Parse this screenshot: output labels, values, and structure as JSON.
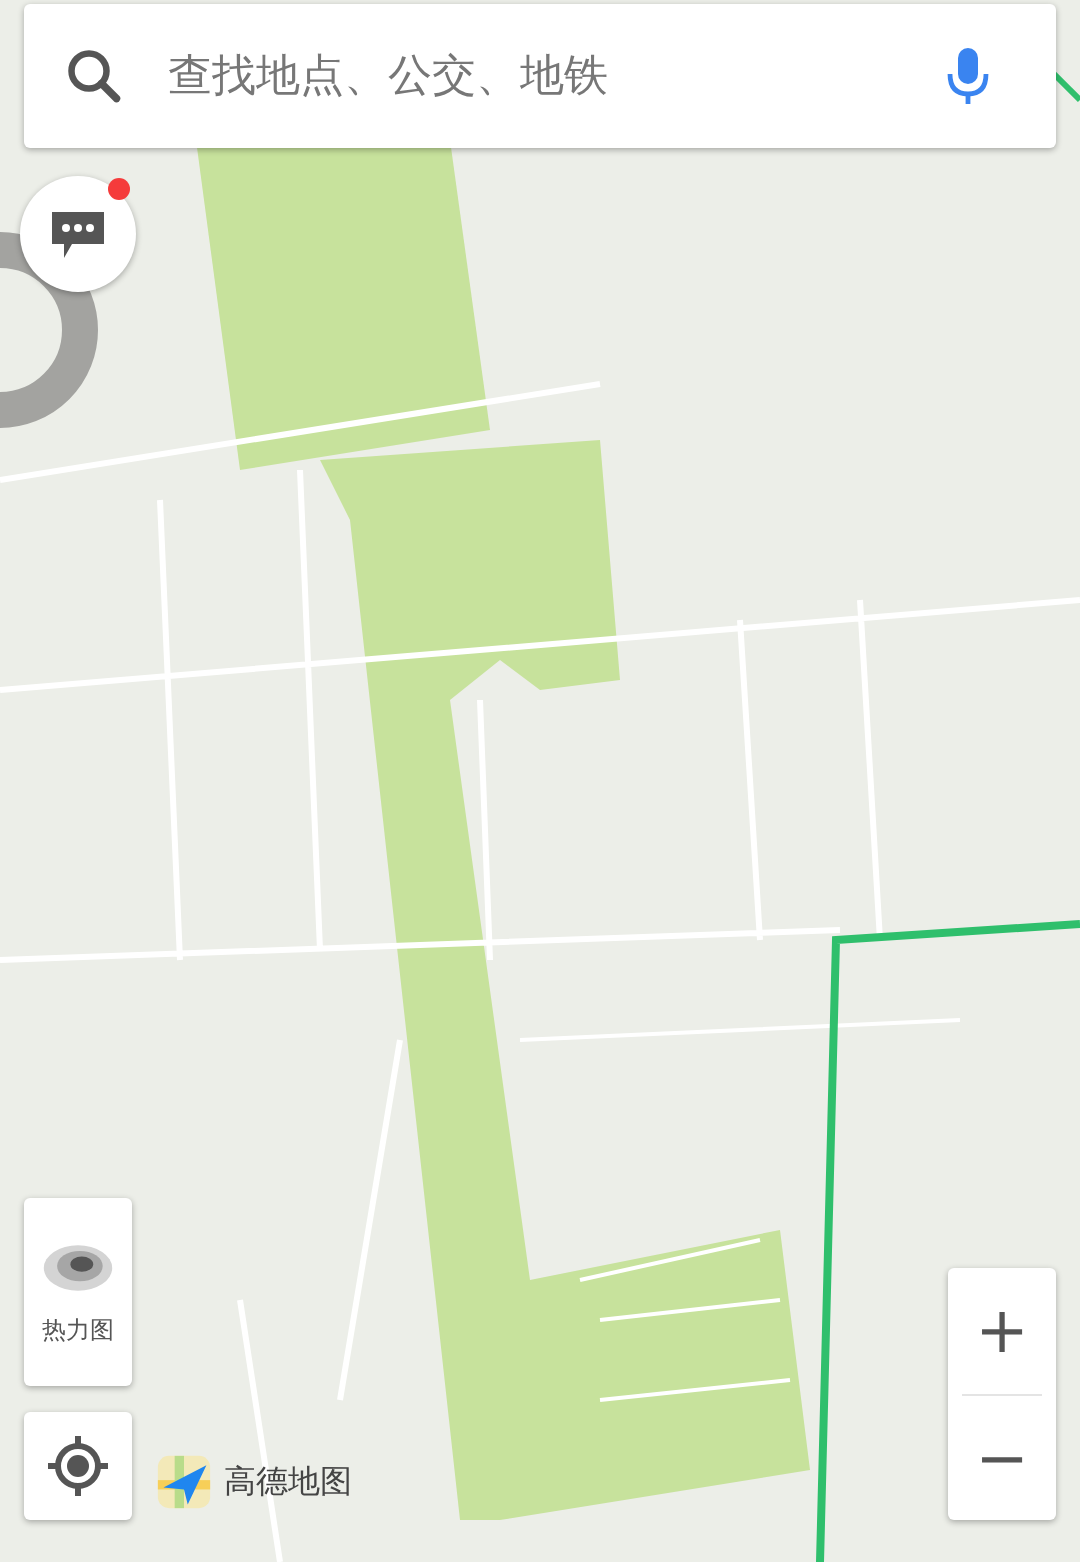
{
  "search": {
    "placeholder": "查找地点、公交、地铁"
  },
  "messages": {
    "unread": true
  },
  "heatmap_button": {
    "label": "热力图"
  },
  "logo": {
    "text": "高德地图"
  },
  "zoom": {
    "in": "+",
    "out": "−"
  }
}
